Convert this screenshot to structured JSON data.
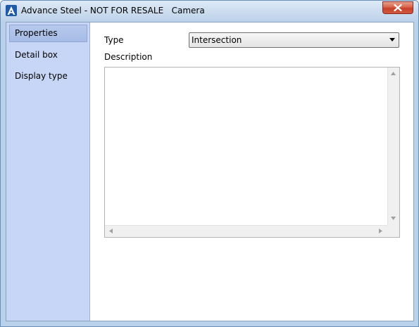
{
  "window": {
    "title": "Advance Steel - NOT FOR RESALE   Camera",
    "app_icon": "advance-steel-logo-icon",
    "close_icon": "close-icon"
  },
  "sidebar": {
    "items": [
      {
        "label": "Properties",
        "selected": true
      },
      {
        "label": "Detail box",
        "selected": false
      },
      {
        "label": "Display type",
        "selected": false
      }
    ]
  },
  "properties": {
    "type_label": "Type",
    "type_value": "Intersection",
    "description_label": "Description",
    "description_value": ""
  },
  "colors": {
    "title_bar": "#cfdff0",
    "sidebar_bg": "#c7d6f7",
    "selected_item": "#a6bbe6",
    "close_button": "#c6412a"
  }
}
